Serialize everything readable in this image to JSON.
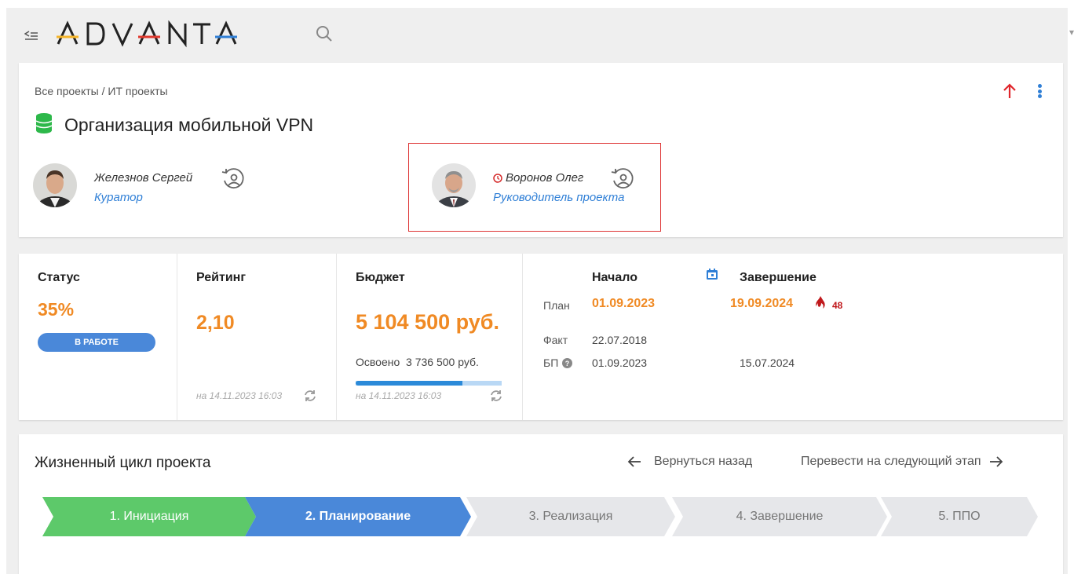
{
  "header": {
    "logo_text": "ADVANTA"
  },
  "breadcrumb": {
    "all_projects": "Все проекты",
    "separator": " / ",
    "category": "ИТ проекты"
  },
  "project": {
    "title": "Организация мобильной VPN",
    "icon": "database-icon",
    "icon_color": "#2db84a"
  },
  "people": [
    {
      "name": "Железнов Сергей",
      "role": "Куратор",
      "overdue_icon": false
    },
    {
      "name": "Воронов Олег",
      "role": "Руководитель проекта",
      "overdue_icon": true
    }
  ],
  "stats": {
    "status": {
      "label": "Статус",
      "percent": "35%",
      "badge": "В РАБОТЕ"
    },
    "rating": {
      "label": "Рейтинг",
      "value": "2,10",
      "updated": "на 14.11.2023 16:03"
    },
    "budget": {
      "label": "Бюджет",
      "value": "5 104 500 руб.",
      "spent_label": "Освоено",
      "spent_value": "3 736 500 руб.",
      "spent_fraction": 0.73,
      "updated": "на 14.11.2023 16:03"
    },
    "dates": {
      "start_header": "Начало",
      "end_header": "Завершение",
      "rows": [
        {
          "label": "План",
          "start": "01.09.2023",
          "end": "19.09.2024",
          "overdue_days": "48"
        },
        {
          "label": "Факт",
          "start": "22.07.2018",
          "end": ""
        },
        {
          "label": "БП",
          "start": "01.09.2023",
          "end": "15.07.2024"
        }
      ]
    }
  },
  "lifecycle": {
    "title": "Жизненный цикл проекта",
    "back_label": "Вернуться назад",
    "next_label": "Перевести на следующий этап",
    "stages": [
      {
        "label": "1. Инициация",
        "state": "done",
        "color": "#5dc96a"
      },
      {
        "label": "2. Планирование",
        "state": "current",
        "color": "#4a88d9"
      },
      {
        "label": "3. Реализация",
        "state": "pending",
        "color": "#e6e7ea"
      },
      {
        "label": "4. Завершение",
        "state": "pending",
        "color": "#e6e7ea"
      },
      {
        "label": "5. ППО",
        "state": "pending",
        "color": "#e6e7ea"
      }
    ]
  },
  "colors": {
    "accent_blue": "#2f7fd6",
    "orange": "#f08a24",
    "alert_red": "#c0191c"
  }
}
